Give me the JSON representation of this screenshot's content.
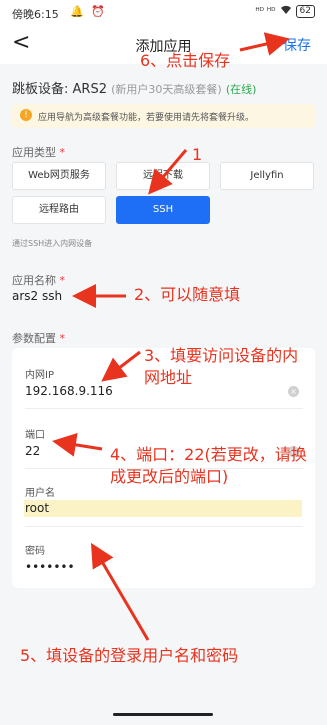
{
  "status_bar": {
    "time": "傍晚6:15",
    "notif_icons": "🔔 ⏰",
    "signal_icons": "ᴴᴰ ᴴᴰ",
    "battery": "62"
  },
  "header": {
    "back_glyph": "<",
    "title": "添加应用",
    "save_label": "保存"
  },
  "device": {
    "label": "跳板设备: ARS2",
    "note": "(新用户30天高级套餐)",
    "status": "(在线)"
  },
  "tip": {
    "icon_glyph": "!",
    "text": "应用导航为高级套餐功能，若要使用请先将套餐升级。"
  },
  "app_type": {
    "label": "应用类型",
    "required_mark": "*",
    "options": [
      "Web网页服务",
      "远程下载",
      "Jellyfin",
      "远程路由",
      "SSH"
    ],
    "selected": "SSH",
    "hint": "通过SSH进入内网设备"
  },
  "app_name": {
    "label": "应用名称",
    "required_mark": "*",
    "value": "ars2 ssh"
  },
  "params": {
    "label": "参数配置",
    "required_mark": "*",
    "ip_label": "内网IP",
    "ip_value": "192.168.9.116",
    "port_label": "端口",
    "port_value": "22",
    "user_label": "用户名",
    "user_value": "root",
    "pass_label": "密码",
    "pass_value": "•••••••"
  },
  "annotations": {
    "a1": "1",
    "a2": "2、可以随意填",
    "a3": "3、填要访问设备的内网地址",
    "a4": "4、端口：22(若更改，请换成更改后的端口)",
    "a5": "5、填设备的登录用户名和密码",
    "a6": "6、点击保存"
  },
  "colors": {
    "accent": "#1e6ff5",
    "annotation": "#e8331f",
    "online": "#2eaa4f"
  }
}
